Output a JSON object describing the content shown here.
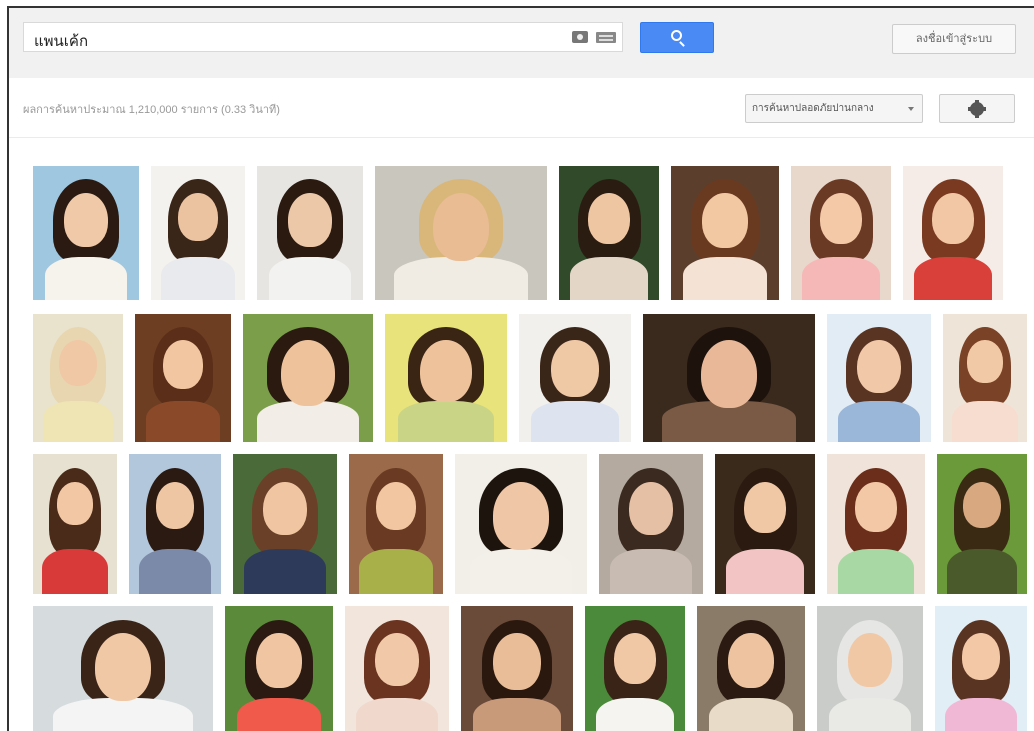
{
  "search": {
    "query": "แพนเค้ก",
    "button_aria": "ค้นหา"
  },
  "header": {
    "signin_label": "ลงชื่อเข้าสู่ระบบ"
  },
  "toolbar": {
    "result_stats": "ผลการค้นหาประมาณ 1,210,000 รายการ (0.33 วินาที)",
    "safesearch_label": "การค้นหาปลอดภัยปานกลาง"
  },
  "colors": {
    "accent": "#4a8af4",
    "header_bg": "#f1f1f1"
  },
  "images": [
    {
      "row": 0,
      "bg": "#9fc7df",
      "hair": "#2a1a12",
      "skin": "#f0c9a8",
      "cloth": "#f6f2ec"
    },
    {
      "row": 0,
      "bg": "#f4f2ee",
      "hair": "#3a2618",
      "skin": "#ecc3a0",
      "cloth": "#e8eaee"
    },
    {
      "row": 0,
      "bg": "#e7e5e2",
      "hair": "#2a1a10",
      "skin": "#edc8a8",
      "cloth": "#f2f2f0"
    },
    {
      "row": 0,
      "bg": "#c9c6be",
      "hair": "#d9b77a",
      "skin": "#e9bc94",
      "cloth": "#f0ebe3"
    },
    {
      "row": 0,
      "bg": "#304a2a",
      "hair": "#2b1c12",
      "skin": "#efc6a2",
      "cloth": "#e4d6c6"
    },
    {
      "row": 0,
      "bg": "#5b3e2c",
      "hair": "#6a3a20",
      "skin": "#f2c8a2",
      "cloth": "#f4e2d4"
    },
    {
      "row": 0,
      "bg": "#e8d8cc",
      "hair": "#6b3a24",
      "skin": "#f3c9a8",
      "cloth": "#f6b8b6"
    },
    {
      "row": 0,
      "bg": "#f5ece8",
      "hair": "#7a3a22",
      "skin": "#f1c7a6",
      "cloth": "#d9403a"
    },
    {
      "row": 1,
      "bg": "#e9e3cd",
      "hair": "#e8d6b0",
      "skin": "#f0c8a6",
      "cloth": "#efe4b4"
    },
    {
      "row": 1,
      "bg": "#6d3e22",
      "hair": "#5a2e18",
      "skin": "#f2c6a0",
      "cloth": "#8a4a2a"
    },
    {
      "row": 1,
      "bg": "#7a9e4a",
      "hair": "#2a1a10",
      "skin": "#eec39c",
      "cloth": "#f2ede6"
    },
    {
      "row": 1,
      "bg": "#e8e37a",
      "hair": "#3a2414",
      "skin": "#eec39c",
      "cloth": "#c9d486"
    },
    {
      "row": 1,
      "bg": "#f2f0ec",
      "hair": "#3a2618",
      "skin": "#efc8a6",
      "cloth": "#dde4ef"
    },
    {
      "row": 1,
      "bg": "#3a2a1e",
      "hair": "#1e120c",
      "skin": "#e8b898",
      "cloth": "#7a5a44"
    },
    {
      "row": 1,
      "bg": "#e2ecf4",
      "hair": "#5a3422",
      "skin": "#f1c9a8",
      "cloth": "#9ab6d8"
    },
    {
      "row": 1,
      "bg": "#efe4d8",
      "hair": "#7a4226",
      "skin": "#f2c9a6",
      "cloth": "#f6ddd0"
    },
    {
      "row": 2,
      "bg": "#e7e1d2",
      "hair": "#4a2a18",
      "skin": "#f1c7a4",
      "cloth": "#d83a3a"
    },
    {
      "row": 2,
      "bg": "#b2c6dc",
      "hair": "#2a1a12",
      "skin": "#efc6a4",
      "cloth": "#7a8aa8"
    },
    {
      "row": 2,
      "bg": "#4a6a3a",
      "hair": "#6a4028",
      "skin": "#f0c6a2",
      "cloth": "#2e3a5a"
    },
    {
      "row": 2,
      "bg": "#9a6a4a",
      "hair": "#6a3a22",
      "skin": "#f1c6a0",
      "cloth": "#a8b04a"
    },
    {
      "row": 2,
      "bg": "#f2efe9",
      "hair": "#1e140e",
      "skin": "#efc6a6",
      "cloth": "#f3f0ea"
    },
    {
      "row": 2,
      "bg": "#b4aaa0",
      "hair": "#3a2a20",
      "skin": "#e6c0a4",
      "cloth": "#c8bcb2"
    },
    {
      "row": 2,
      "bg": "#3a2a1c",
      "hair": "#2a1a10",
      "skin": "#f0c8a6",
      "cloth": "#f2c4c4"
    },
    {
      "row": 2,
      "bg": "#efe3da",
      "hair": "#6a2e1a",
      "skin": "#f2c8a6",
      "cloth": "#a8d8a4"
    },
    {
      "row": 2,
      "bg": "#6a9a3a",
      "hair": "#3a2a14",
      "skin": "#d8a880",
      "cloth": "#4a5a2a"
    },
    {
      "row": 3,
      "bg": "#d6dcde",
      "hair": "#3a2418",
      "skin": "#f1c8a6",
      "cloth": "#f4f4f4"
    },
    {
      "row": 3,
      "bg": "#5a8a3a",
      "hair": "#2a1a12",
      "skin": "#f0c6a2",
      "cloth": "#ef5a4a"
    },
    {
      "row": 3,
      "bg": "#f1e5dc",
      "hair": "#6a3420",
      "skin": "#f2c9a8",
      "cloth": "#f0d8cc"
    },
    {
      "row": 3,
      "bg": "#6a4a38",
      "hair": "#2a180e",
      "skin": "#e9bd98",
      "cloth": "#c89a7a"
    },
    {
      "row": 3,
      "bg": "#4a8a3a",
      "hair": "#3a2418",
      "skin": "#f1c8a6",
      "cloth": "#f6f4f0"
    },
    {
      "row": 3,
      "bg": "#8a7a68",
      "hair": "#2a1a12",
      "skin": "#eec4a0",
      "cloth": "#e8dcc8"
    },
    {
      "row": 3,
      "bg": "#c9ccc8",
      "hair": "#e6e6e4",
      "skin": "#f1c8a6",
      "cloth": "#e9e9e6"
    },
    {
      "row": 3,
      "bg": "#e2eef6",
      "hair": "#5a3422",
      "skin": "#f2c8a6",
      "cloth": "#f1b8d6"
    }
  ]
}
